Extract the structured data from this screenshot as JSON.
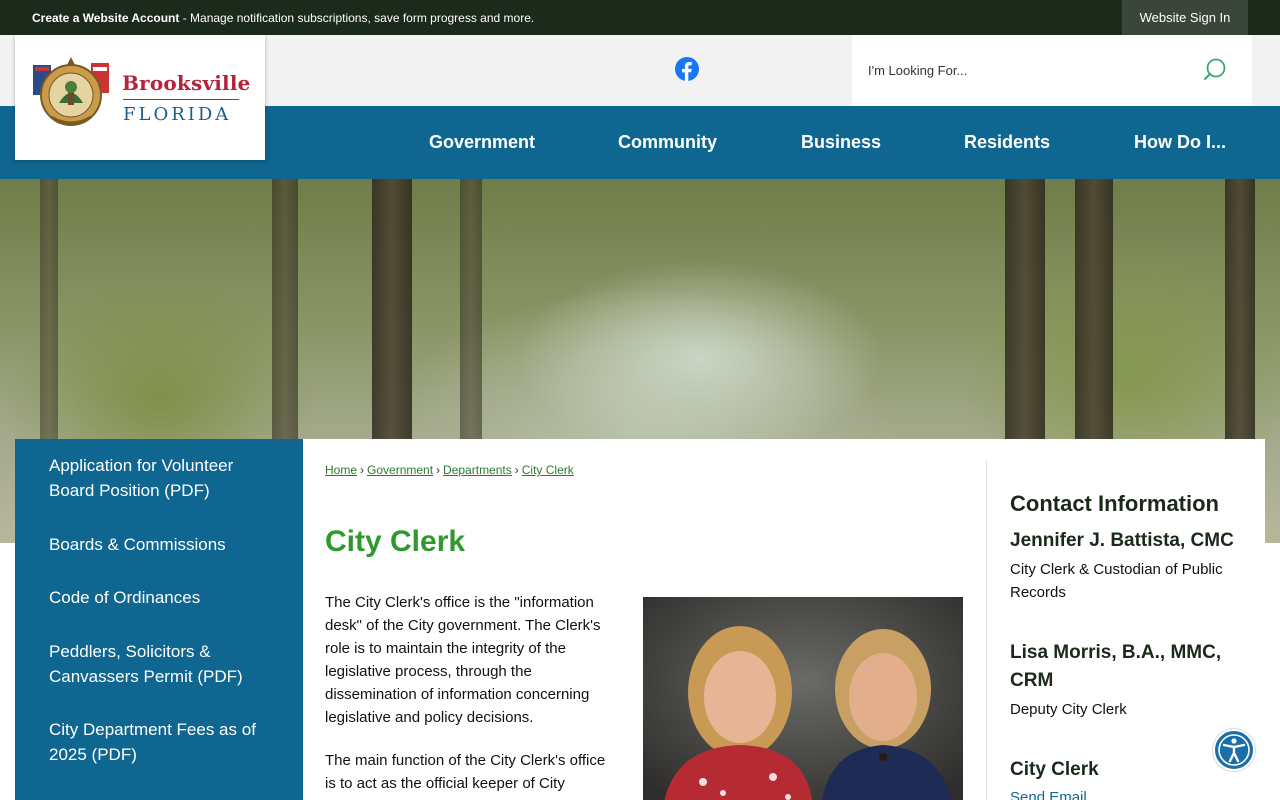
{
  "topbar": {
    "account_title": "Create a Website Account",
    "account_desc": " - Manage notification subscriptions, save form progress and more.",
    "sign_in": "Website Sign In"
  },
  "logo": {
    "city": "Brooksville",
    "state": "FLORIDA",
    "brand_red": "#b3243a",
    "brand_blue": "#1d5d86"
  },
  "social": {
    "icon": "facebook-icon",
    "color": "#1877f2"
  },
  "search": {
    "placeholder": "I'm Looking For...",
    "icon": "search-icon"
  },
  "nav": {
    "items": [
      "Government",
      "Community",
      "Business",
      "Residents",
      "How Do I..."
    ],
    "color": "#0f6690"
  },
  "sidebar": {
    "links": [
      "Application for Volunteer Board Position (PDF)",
      "Boards & Commissions",
      "Code of Ordinances",
      "Peddlers, Solicitors & Canvassers Permit (PDF)",
      "City Department Fees as of 2025 (PDF)"
    ]
  },
  "breadcrumb": [
    "Home",
    "Government",
    "Departments",
    "City Clerk"
  ],
  "page": {
    "title": "City Clerk",
    "title_color": "#2e9a2e",
    "paragraph1": "The City Clerk's office is the \"information desk\" of the City government. The Clerk's role is to maintain the integrity of the legislative process, through the dissemination of information concerning legislative and policy decisions.",
    "paragraph2": "The main function of the City Clerk's office is to act as the official keeper of City records and to record the proceedings of"
  },
  "contact": {
    "heading": "Contact Information",
    "people": [
      {
        "name": "Jennifer J. Battista, CMC",
        "role": "City Clerk & Custodian of Public Records"
      },
      {
        "name": "Lisa Morris, B.A., MMC, CRM",
        "role": "Deputy City Clerk"
      }
    ],
    "office": "City Clerk",
    "email_link": "Send Email"
  },
  "accessibility": {
    "icon": "accessibility-icon"
  }
}
